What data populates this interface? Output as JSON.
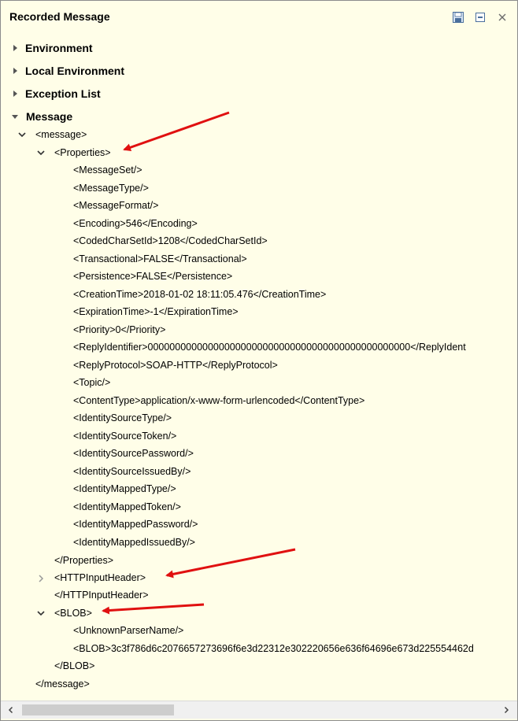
{
  "panel": {
    "title": "Recorded Message",
    "icons": [
      "save-icon",
      "minimize-icon",
      "close-icon"
    ]
  },
  "sections": {
    "environment": "Environment",
    "local_environment": "Local Environment",
    "exception_list": "Exception List",
    "message": "Message"
  },
  "tree": {
    "message_open": "<message>",
    "properties_open": "<Properties>",
    "properties_items": [
      "<MessageSet/>",
      "<MessageType/>",
      "<MessageFormat/>",
      "<Encoding>546</Encoding>",
      "<CodedCharSetId>1208</CodedCharSetId>",
      "<Transactional>FALSE</Transactional>",
      "<Persistence>FALSE</Persistence>",
      "<CreationTime>2018-01-02 18:11:05.476</CreationTime>",
      "<ExpirationTime>-1</ExpirationTime>",
      "<Priority>0</Priority>",
      "<ReplyIdentifier>000000000000000000000000000000000000000000000000</ReplyIdent",
      "<ReplyProtocol>SOAP-HTTP</ReplyProtocol>",
      "<Topic/>",
      "<ContentType>application/x-www-form-urlencoded</ContentType>",
      "<IdentitySourceType/>",
      "<IdentitySourceToken/>",
      "<IdentitySourcePassword/>",
      "<IdentitySourceIssuedBy/>",
      "<IdentityMappedType/>",
      "<IdentityMappedToken/>",
      "<IdentityMappedPassword/>",
      "<IdentityMappedIssuedBy/>"
    ],
    "properties_close": "</Properties>",
    "httpinputheader_open": "<HTTPInputHeader>",
    "httpinputheader_close": "</HTTPInputHeader>",
    "blob_open": "<BLOB>",
    "blob_items": [
      "<UnknownParserName/>",
      "<BLOB>3c3f786d6c2076657273696f6e3d22312e302220656e636f64696e673d225554462d"
    ],
    "blob_close": "</BLOB>",
    "message_close": "</message>"
  },
  "colors": {
    "annotation_arrow": "#e01010",
    "background": "#fffee8"
  }
}
